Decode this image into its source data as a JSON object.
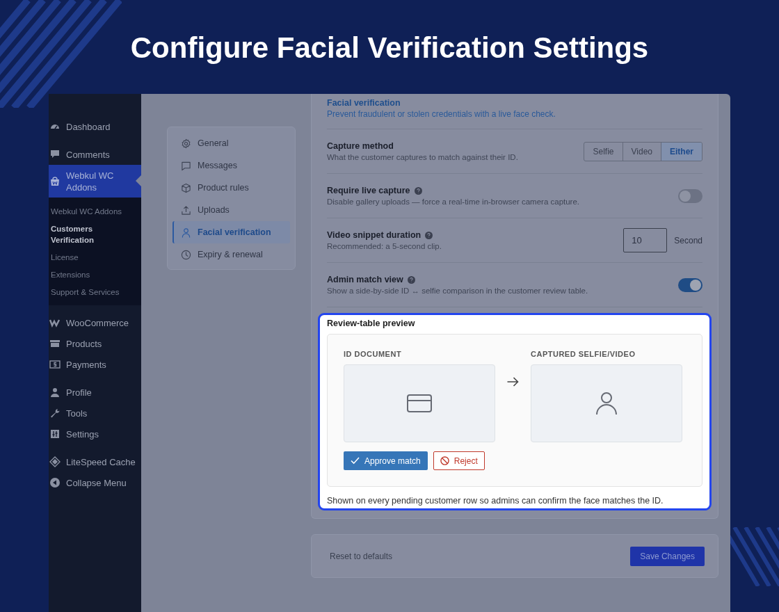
{
  "headline": "Configure Facial Verification Settings",
  "sidebar": {
    "groups": [
      {
        "items": [
          {
            "label": "Dashboard",
            "selected": false
          }
        ]
      },
      {
        "items": [
          {
            "label": "Comments",
            "selected": false
          },
          {
            "label": "Webkul WC Addons",
            "selected": true,
            "submenu": [
              {
                "label": "Webkul WC Addons",
                "selected": false
              },
              {
                "label": "Customers Verification",
                "selected": true
              },
              {
                "label": "License",
                "selected": false
              },
              {
                "label": "Extensions",
                "selected": false
              },
              {
                "label": "Support & Services",
                "selected": false
              }
            ]
          }
        ]
      },
      {
        "items": [
          {
            "label": "WooCommerce",
            "selected": false
          },
          {
            "label": "Products",
            "selected": false
          },
          {
            "label": "Payments",
            "selected": false
          }
        ]
      },
      {
        "items": [
          {
            "label": "Profile",
            "selected": false
          },
          {
            "label": "Tools",
            "selected": false
          },
          {
            "label": "Settings",
            "selected": false
          }
        ]
      },
      {
        "items": [
          {
            "label": "LiteSpeed Cache",
            "selected": false
          },
          {
            "label": "Collapse Menu",
            "selected": false
          }
        ]
      }
    ]
  },
  "settings_nav": [
    {
      "label": "General",
      "selected": false
    },
    {
      "label": "Messages",
      "selected": false
    },
    {
      "label": "Product rules",
      "selected": false
    },
    {
      "label": "Uploads",
      "selected": false
    },
    {
      "label": "Facial verification",
      "selected": true
    },
    {
      "label": "Expiry & renewal",
      "selected": false
    }
  ],
  "section": {
    "title": "Facial verification",
    "subtitle": "Prevent fraudulent or stolen credentials with a live face check."
  },
  "rows": [
    {
      "kind": "segmented",
      "label": "Capture method",
      "help": false,
      "description": "What the customer captures to match against their ID.",
      "options": [
        {
          "label": "Selfie",
          "selected": false
        },
        {
          "label": "Video",
          "selected": false
        },
        {
          "label": "Either",
          "selected": true
        }
      ]
    },
    {
      "kind": "toggle",
      "label": "Require live capture",
      "help": true,
      "description": "Disable gallery uploads — force a real-time in-browser camera capture.",
      "on": false
    },
    {
      "kind": "number",
      "label": "Video snippet duration",
      "help": true,
      "description": "Recommended: a 5-second clip.",
      "value": "10",
      "unit": "Second"
    },
    {
      "kind": "toggle",
      "label": "Admin match view",
      "help": true,
      "description": "Show a side-by-side ID ↔ selfie comparison in the customer review table.",
      "on": true
    }
  ],
  "preview": {
    "title": "Review-table preview",
    "id_label": "ID DOCUMENT",
    "capture_label": "CAPTURED SELFIE/VIDEO",
    "approve": "Approve match",
    "reject": "Reject",
    "note": "Shown on every pending customer row so admins can confirm the face matches the ID."
  },
  "footer": {
    "reset": "Reset to defaults",
    "save": "Save Changes"
  }
}
